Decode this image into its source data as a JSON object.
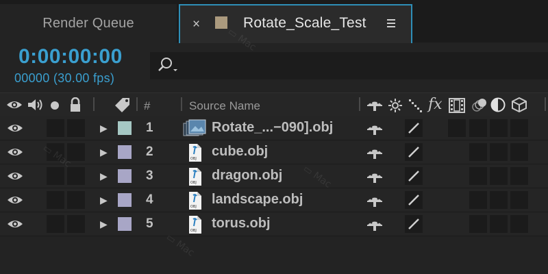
{
  "tabs": {
    "render_queue": "Render Queue",
    "active": {
      "close": "×",
      "title": "Rotate_Scale_Test",
      "swatch_color": "#ab9a7e"
    }
  },
  "time": {
    "timecode": "0:00:00:00",
    "frames": "00000 (30.00 fps)"
  },
  "search": {
    "icon": "search-icon"
  },
  "header": {
    "number_label": "#",
    "source_name_label": "Source Name",
    "fx_label": "fx",
    "icons": [
      "eye-icon",
      "speaker-icon",
      "solo-icon",
      "lock-icon",
      "label-tag-icon",
      "shy-icon",
      "collapse-sun-icon",
      "quality-icon",
      "fx-icon",
      "frame-blending-icon",
      "motion-blur-icon",
      "adjustment-layer-icon",
      "3d-layer-icon"
    ]
  },
  "layers": [
    {
      "number": "1",
      "name": "Rotate_...−090].obj",
      "label_color": "#a6c8c4",
      "file_icon": "image-sequence-icon"
    },
    {
      "number": "2",
      "name": "cube.obj",
      "label_color": "#a8a6c6",
      "file_icon": "obj-file-icon"
    },
    {
      "number": "3",
      "name": "dragon.obj",
      "label_color": "#a8a6c6",
      "file_icon": "obj-file-icon"
    },
    {
      "number": "4",
      "name": "landscape.obj",
      "label_color": "#a8a6c6",
      "file_icon": "obj-file-icon"
    },
    {
      "number": "5",
      "name": "torus.obj",
      "label_color": "#a8a6c6",
      "file_icon": "obj-file-icon"
    }
  ],
  "colors": {
    "accent": "#3a9fcf",
    "tab_border": "#2e8fb8",
    "background": "#232323"
  },
  "watermark": "Mac天空"
}
